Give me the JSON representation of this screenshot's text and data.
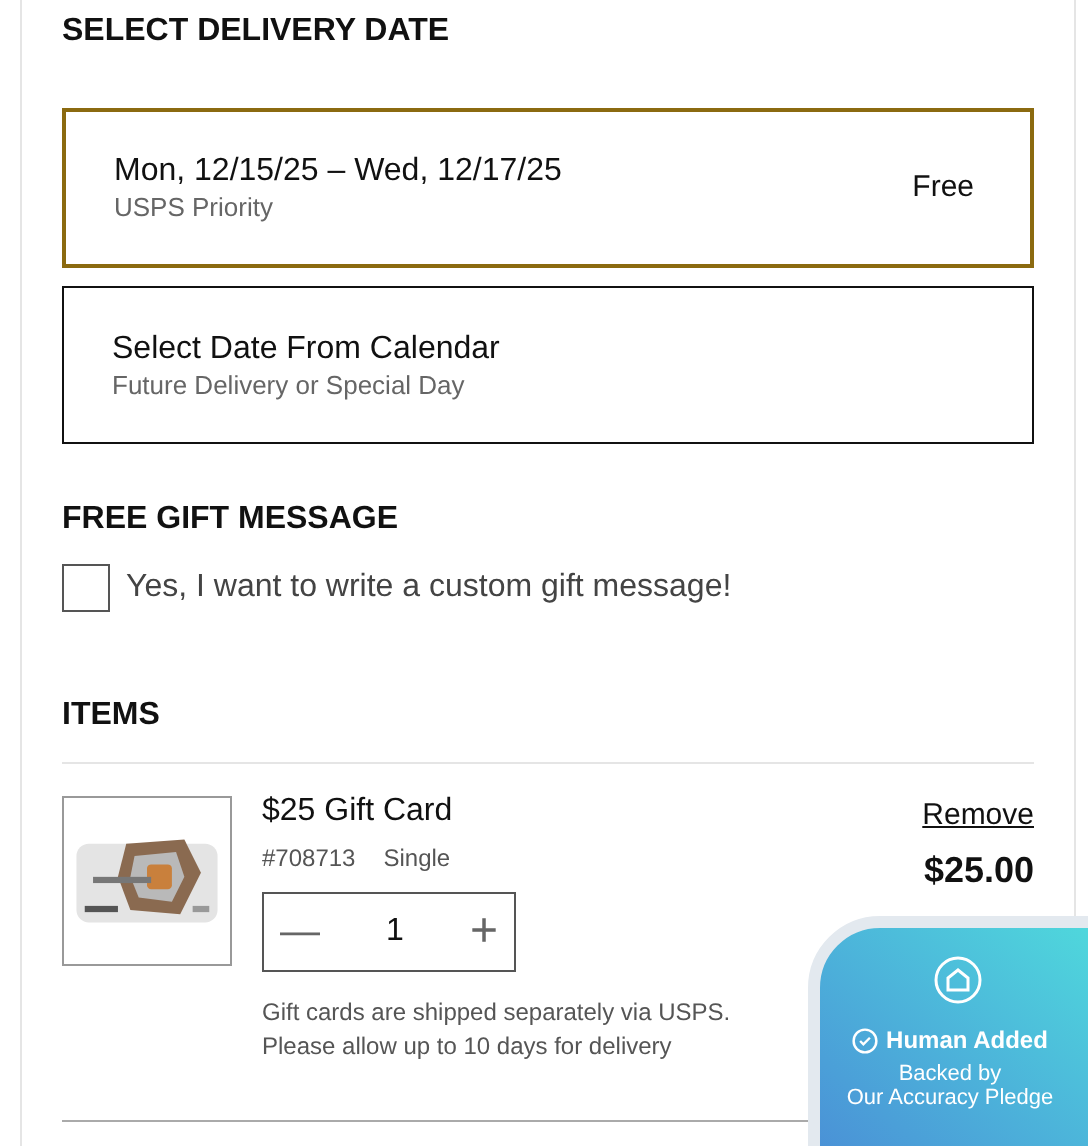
{
  "delivery": {
    "title": "SELECT DELIVERY DATE",
    "options": [
      {
        "label": "Mon, 12/15/25 – Wed, 12/17/25",
        "sublabel": "USPS Priority",
        "price": "Free",
        "selected": true
      },
      {
        "label": "Select Date From Calendar",
        "sublabel": "Future Delivery or Special Day",
        "selected": false
      }
    ]
  },
  "gift_message": {
    "title": "FREE GIFT MESSAGE",
    "label": "Yes, I want to write a custom gift message!",
    "checked": false
  },
  "items": {
    "title": "ITEMS",
    "list": [
      {
        "name": "$25 Gift Card",
        "sku": "#708713",
        "variant": "Single",
        "quantity": "1",
        "minus": "—",
        "plus": "+",
        "remove": "Remove",
        "price": "$25.00",
        "note": "Gift cards are shipped separately via USPS.\nPlease allow up to 10 days for delivery"
      }
    ]
  },
  "badge": {
    "title": "Human Added",
    "subtitle": "Backed by\nOur Accuracy Pledge"
  }
}
